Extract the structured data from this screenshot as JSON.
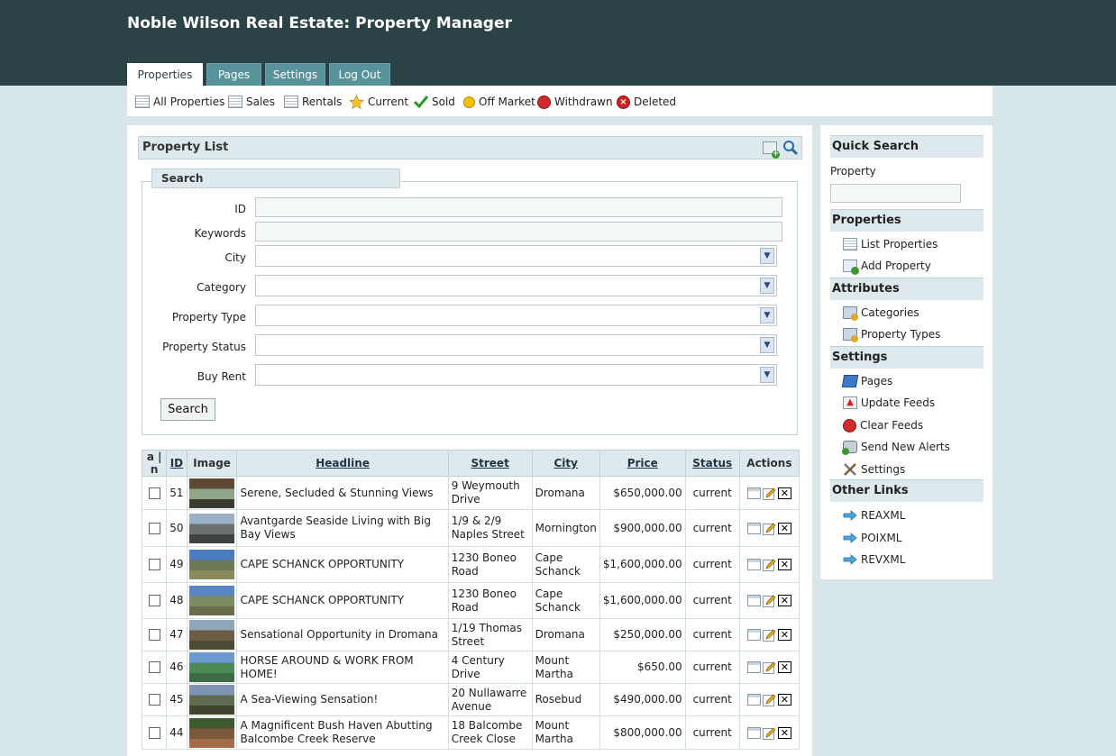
{
  "app_title": "Noble Wilson Real Estate: Property Manager",
  "tabs": [
    {
      "label": "Properties",
      "active": true
    },
    {
      "label": "Pages",
      "active": false
    },
    {
      "label": "Settings",
      "active": false
    },
    {
      "label": "Log Out",
      "active": false
    }
  ],
  "subnav": [
    {
      "label": "All Properties",
      "icon": "list-icon"
    },
    {
      "label": "Sales",
      "icon": "list-icon"
    },
    {
      "label": "Rentals",
      "icon": "list-icon"
    },
    {
      "label": "Current",
      "icon": "star-icon"
    },
    {
      "label": "Sold",
      "icon": "check-icon"
    },
    {
      "label": "Off Market",
      "icon": "yellow-circle-icon"
    },
    {
      "label": "Withdrawn",
      "icon": "withdrawn-icon"
    },
    {
      "label": "Deleted",
      "icon": "deleted-icon"
    }
  ],
  "panel": {
    "title": "Property List"
  },
  "search": {
    "legend": "Search",
    "fields": {
      "id": {
        "label": "ID",
        "value": ""
      },
      "keywords": {
        "label": "Keywords",
        "value": ""
      },
      "city": {
        "label": "City",
        "value": ""
      },
      "category": {
        "label": "Category",
        "value": ""
      },
      "property_type": {
        "label": "Property Type",
        "value": ""
      },
      "property_status": {
        "label": "Property Status",
        "value": ""
      },
      "buy_rent": {
        "label": "Buy Rent",
        "value": ""
      }
    },
    "button": "Search"
  },
  "table": {
    "headers": {
      "select": "a | n",
      "id": "ID",
      "image": "Image",
      "headline": "Headline",
      "street": "Street",
      "city": "City",
      "price": "Price",
      "status": "Status",
      "actions": "Actions"
    },
    "rows": [
      {
        "id": "51",
        "headline": "Serene, Secluded & Stunning Views",
        "street": "9 Weymouth Drive",
        "city": "Dromana",
        "price": "$650,000.00",
        "status": "current",
        "thumb": [
          "#5c4a32",
          "#8fa68a",
          "#3b3a2e"
        ]
      },
      {
        "id": "50",
        "headline": "Avantgarde Seaside Living with Big Bay Views",
        "street": "1/9 & 2/9 Naples Street",
        "city": "Mornington",
        "price": "$900,000.00",
        "status": "current",
        "thumb": [
          "#9ab0c6",
          "#6b6f70",
          "#3e4243"
        ]
      },
      {
        "id": "49",
        "headline": "CAPE SCHANCK OPPORTUNITY",
        "street": "1230 Boneo Road",
        "city": "Cape Schanck",
        "price": "$1,600,000.00",
        "status": "current",
        "thumb": [
          "#4c7cc0",
          "#6d7a55",
          "#8a8a5c"
        ]
      },
      {
        "id": "48",
        "headline": "CAPE SCHANCK OPPORTUNITY",
        "street": "1230 Boneo Road",
        "city": "Cape Schanck",
        "price": "$1,600,000.00",
        "status": "current",
        "thumb": [
          "#5a86c4",
          "#7d8b60",
          "#6a6e48"
        ]
      },
      {
        "id": "47",
        "headline": "Sensational Opportunity in Dromana",
        "street": "1/19 Thomas Street",
        "city": "Dromana",
        "price": "$250,000.00",
        "status": "current",
        "thumb": [
          "#8ea7b8",
          "#6d5d44",
          "#4d4a34"
        ]
      },
      {
        "id": "46",
        "headline": "HORSE AROUND & WORK FROM HOME!",
        "street": "4 Century Drive",
        "city": "Mount Martha",
        "price": "$650.00",
        "status": "current",
        "thumb": [
          "#6a9ad0",
          "#4e8a58",
          "#3c6b45"
        ]
      },
      {
        "id": "45",
        "headline": "A Sea-Viewing Sensation!",
        "street": "20 Nullawarre Avenue",
        "city": "Rosebud",
        "price": "$490,000.00",
        "status": "current",
        "thumb": [
          "#7f95b5",
          "#5f6b4e",
          "#40452e"
        ]
      },
      {
        "id": "44",
        "headline": "A Magnificent Bush Haven Abutting Balcombe Creek Reserve",
        "street": "18 Balcombe Creek Close",
        "city": "Mount Martha",
        "price": "$800,000.00",
        "status": "current",
        "thumb": [
          "#3d5a2c",
          "#7a5a3a",
          "#a56b48"
        ]
      }
    ]
  },
  "sidebar": {
    "quick_search": {
      "title": "Quick Search",
      "label": "Property",
      "value": ""
    },
    "properties": {
      "title": "Properties",
      "links": [
        {
          "label": "List Properties",
          "icon": "list-icon"
        },
        {
          "label": "Add Property",
          "icon": "add-icon"
        }
      ]
    },
    "attributes": {
      "title": "Attributes",
      "links": [
        {
          "label": "Categories",
          "icon": "folder-gear-icon"
        },
        {
          "label": "Property Types",
          "icon": "folder-gear-icon"
        }
      ]
    },
    "settings": {
      "title": "Settings",
      "links": [
        {
          "label": "Pages",
          "icon": "pages-icon"
        },
        {
          "label": "Update Feeds",
          "icon": "update-icon"
        },
        {
          "label": "Clear Feeds",
          "icon": "clear-icon"
        },
        {
          "label": "Send New Alerts",
          "icon": "alerts-icon"
        },
        {
          "label": "Settings",
          "icon": "tools-icon"
        }
      ]
    },
    "other_links": {
      "title": "Other Links",
      "links": [
        {
          "label": "REAXML",
          "icon": "arrow-icon"
        },
        {
          "label": "POIXML",
          "icon": "arrow-icon"
        },
        {
          "label": "REVXML",
          "icon": "arrow-icon"
        }
      ]
    }
  },
  "colors": {
    "header_bg": "#2b4247",
    "tab_bg": "#58939b",
    "page_bg": "#d6e6e9",
    "section_bg": "#dde9ec"
  }
}
